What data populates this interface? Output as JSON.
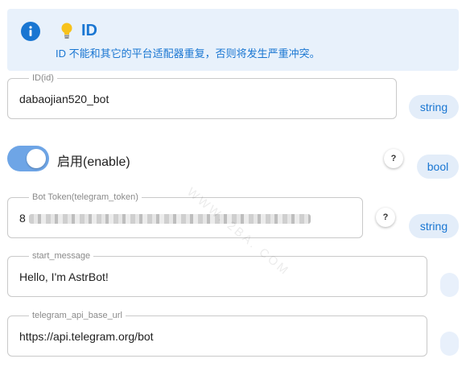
{
  "alert": {
    "icon": "info-icon",
    "emoji_icon": "lightbulb-icon",
    "title": "ID",
    "description": "ID 不能和其它的平台适配器重复，否则将发生严重冲突。",
    "color": "#1976d2",
    "background": "#e8f1fb"
  },
  "fields": {
    "id": {
      "label": "ID(id)",
      "value": "dabaojian520_bot",
      "type": "string"
    },
    "enable": {
      "label": "启用(enable)",
      "checked": true,
      "type": "bool",
      "help": "?"
    },
    "token": {
      "label": "Bot Token(telegram_token)",
      "value_prefix": "8",
      "type": "string",
      "help": "?"
    },
    "start_message": {
      "label": "start_message",
      "value": "Hello, I'm AstrBot!"
    },
    "api_base_url": {
      "label": "telegram_api_base_url",
      "value": "https://api.telegram.org/bot"
    }
  },
  "watermark": "WWW. 2BA. COM"
}
